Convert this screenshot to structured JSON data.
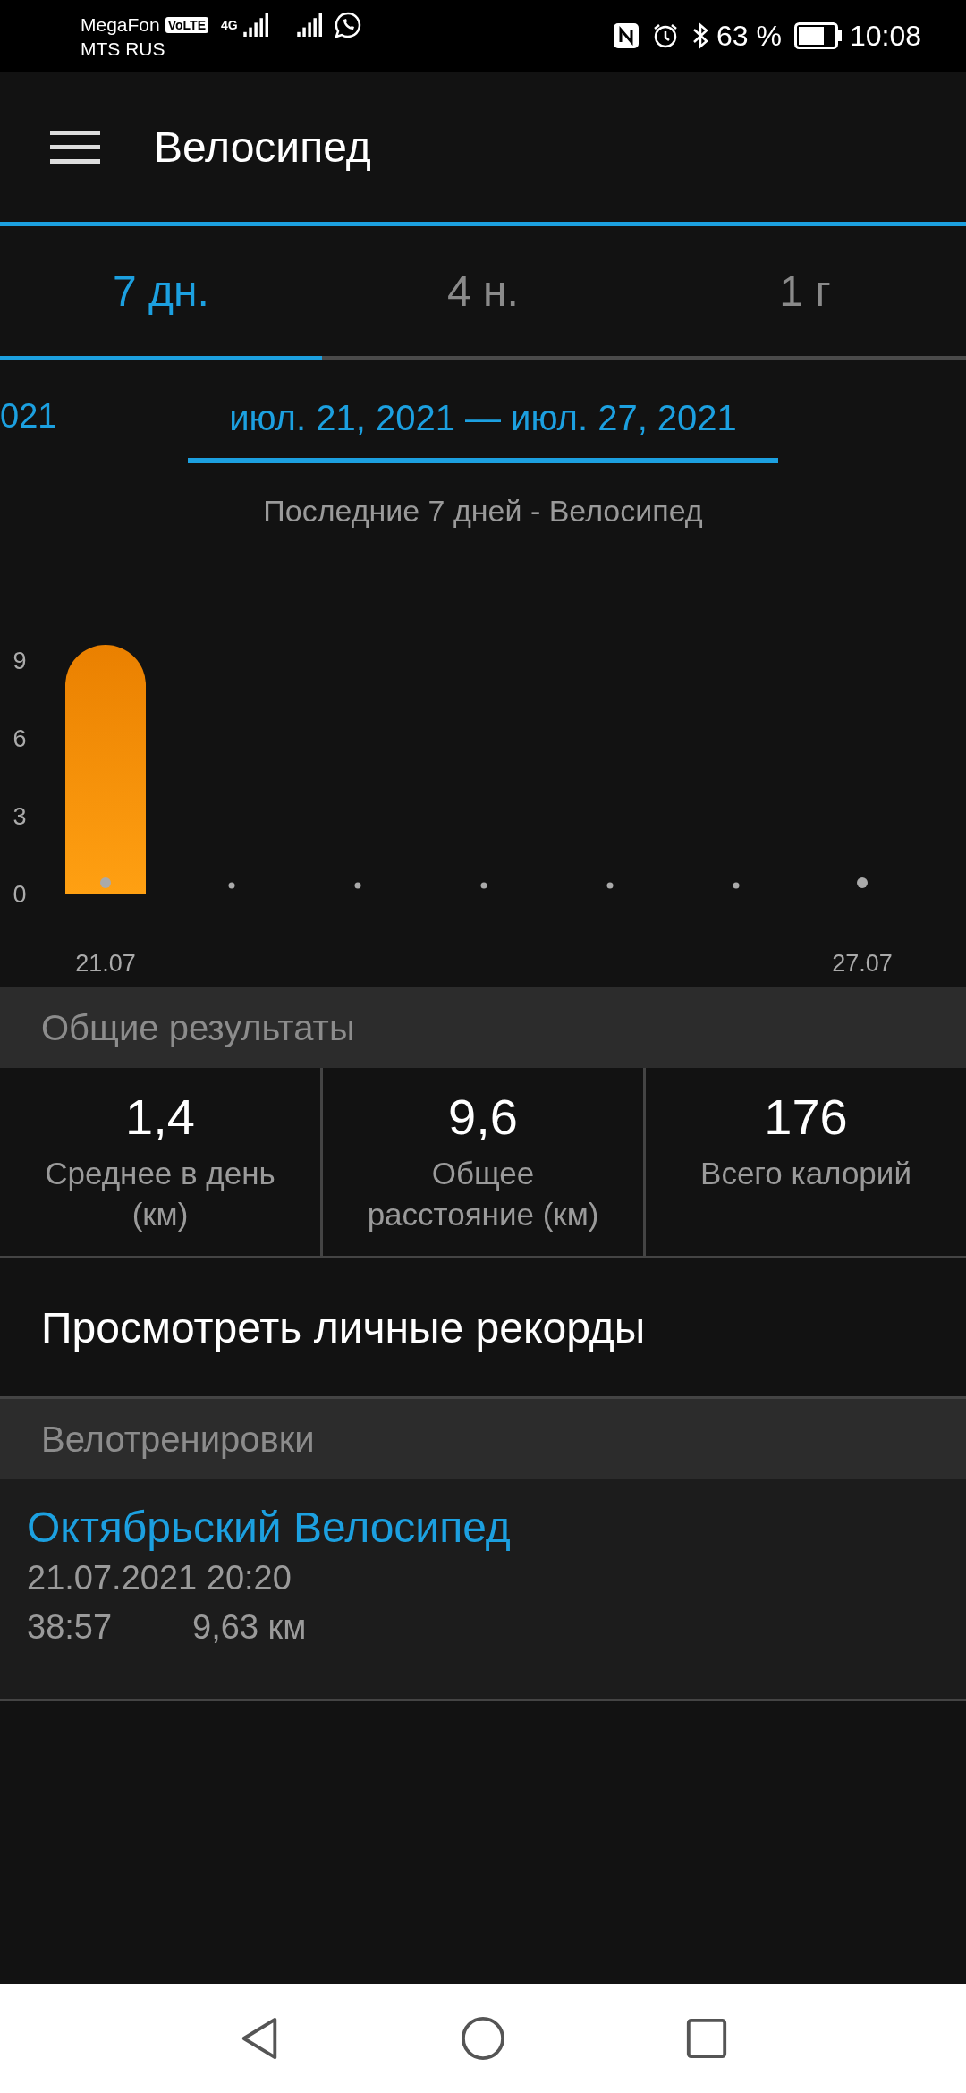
{
  "status_bar": {
    "carrier_1": "MegaFon",
    "volte_badge": "VoLTE",
    "network_type": "4G",
    "carrier_2": "MTS RUS",
    "battery_percent": "63 %",
    "time": "10:08"
  },
  "app_bar": {
    "title": "Велосипед"
  },
  "tabs": [
    {
      "label": "7 дн.",
      "selected": true
    },
    {
      "label": "4 н.",
      "selected": false
    },
    {
      "label": "1 г",
      "selected": false
    }
  ],
  "date_pager": {
    "previous_partial": "021",
    "current": "июл. 21, 2021 — июл. 27, 2021"
  },
  "chart": {
    "chart_data": {
      "type": "bar",
      "title": "Последние 7 дней - Велосипед",
      "categories": [
        "21.07",
        null,
        null,
        null,
        null,
        null,
        "27.07"
      ],
      "series": [
        {
          "color": "#f39200",
          "values": [
            9.6,
            0,
            0,
            0,
            0,
            0,
            0
          ]
        }
      ],
      "ylim": [
        0,
        9.6
      ],
      "yticks": [
        0,
        3,
        6,
        9
      ]
    }
  },
  "summary": {
    "header": "Общие результаты",
    "stats": [
      {
        "value": "1,4",
        "label": "Среднее в день (км)"
      },
      {
        "value": "9,6",
        "label": "Общее расстояние (км)"
      },
      {
        "value": "176",
        "label": "Всего калорий"
      }
    ]
  },
  "records_link": "Просмотреть личные рекорды",
  "activities": {
    "header": "Велотренировки",
    "items": [
      {
        "name": "Октябрьский Велосипед",
        "datetime": "21.07.2021 20:20",
        "duration": "38:57",
        "distance": "9,63 км"
      }
    ]
  }
}
